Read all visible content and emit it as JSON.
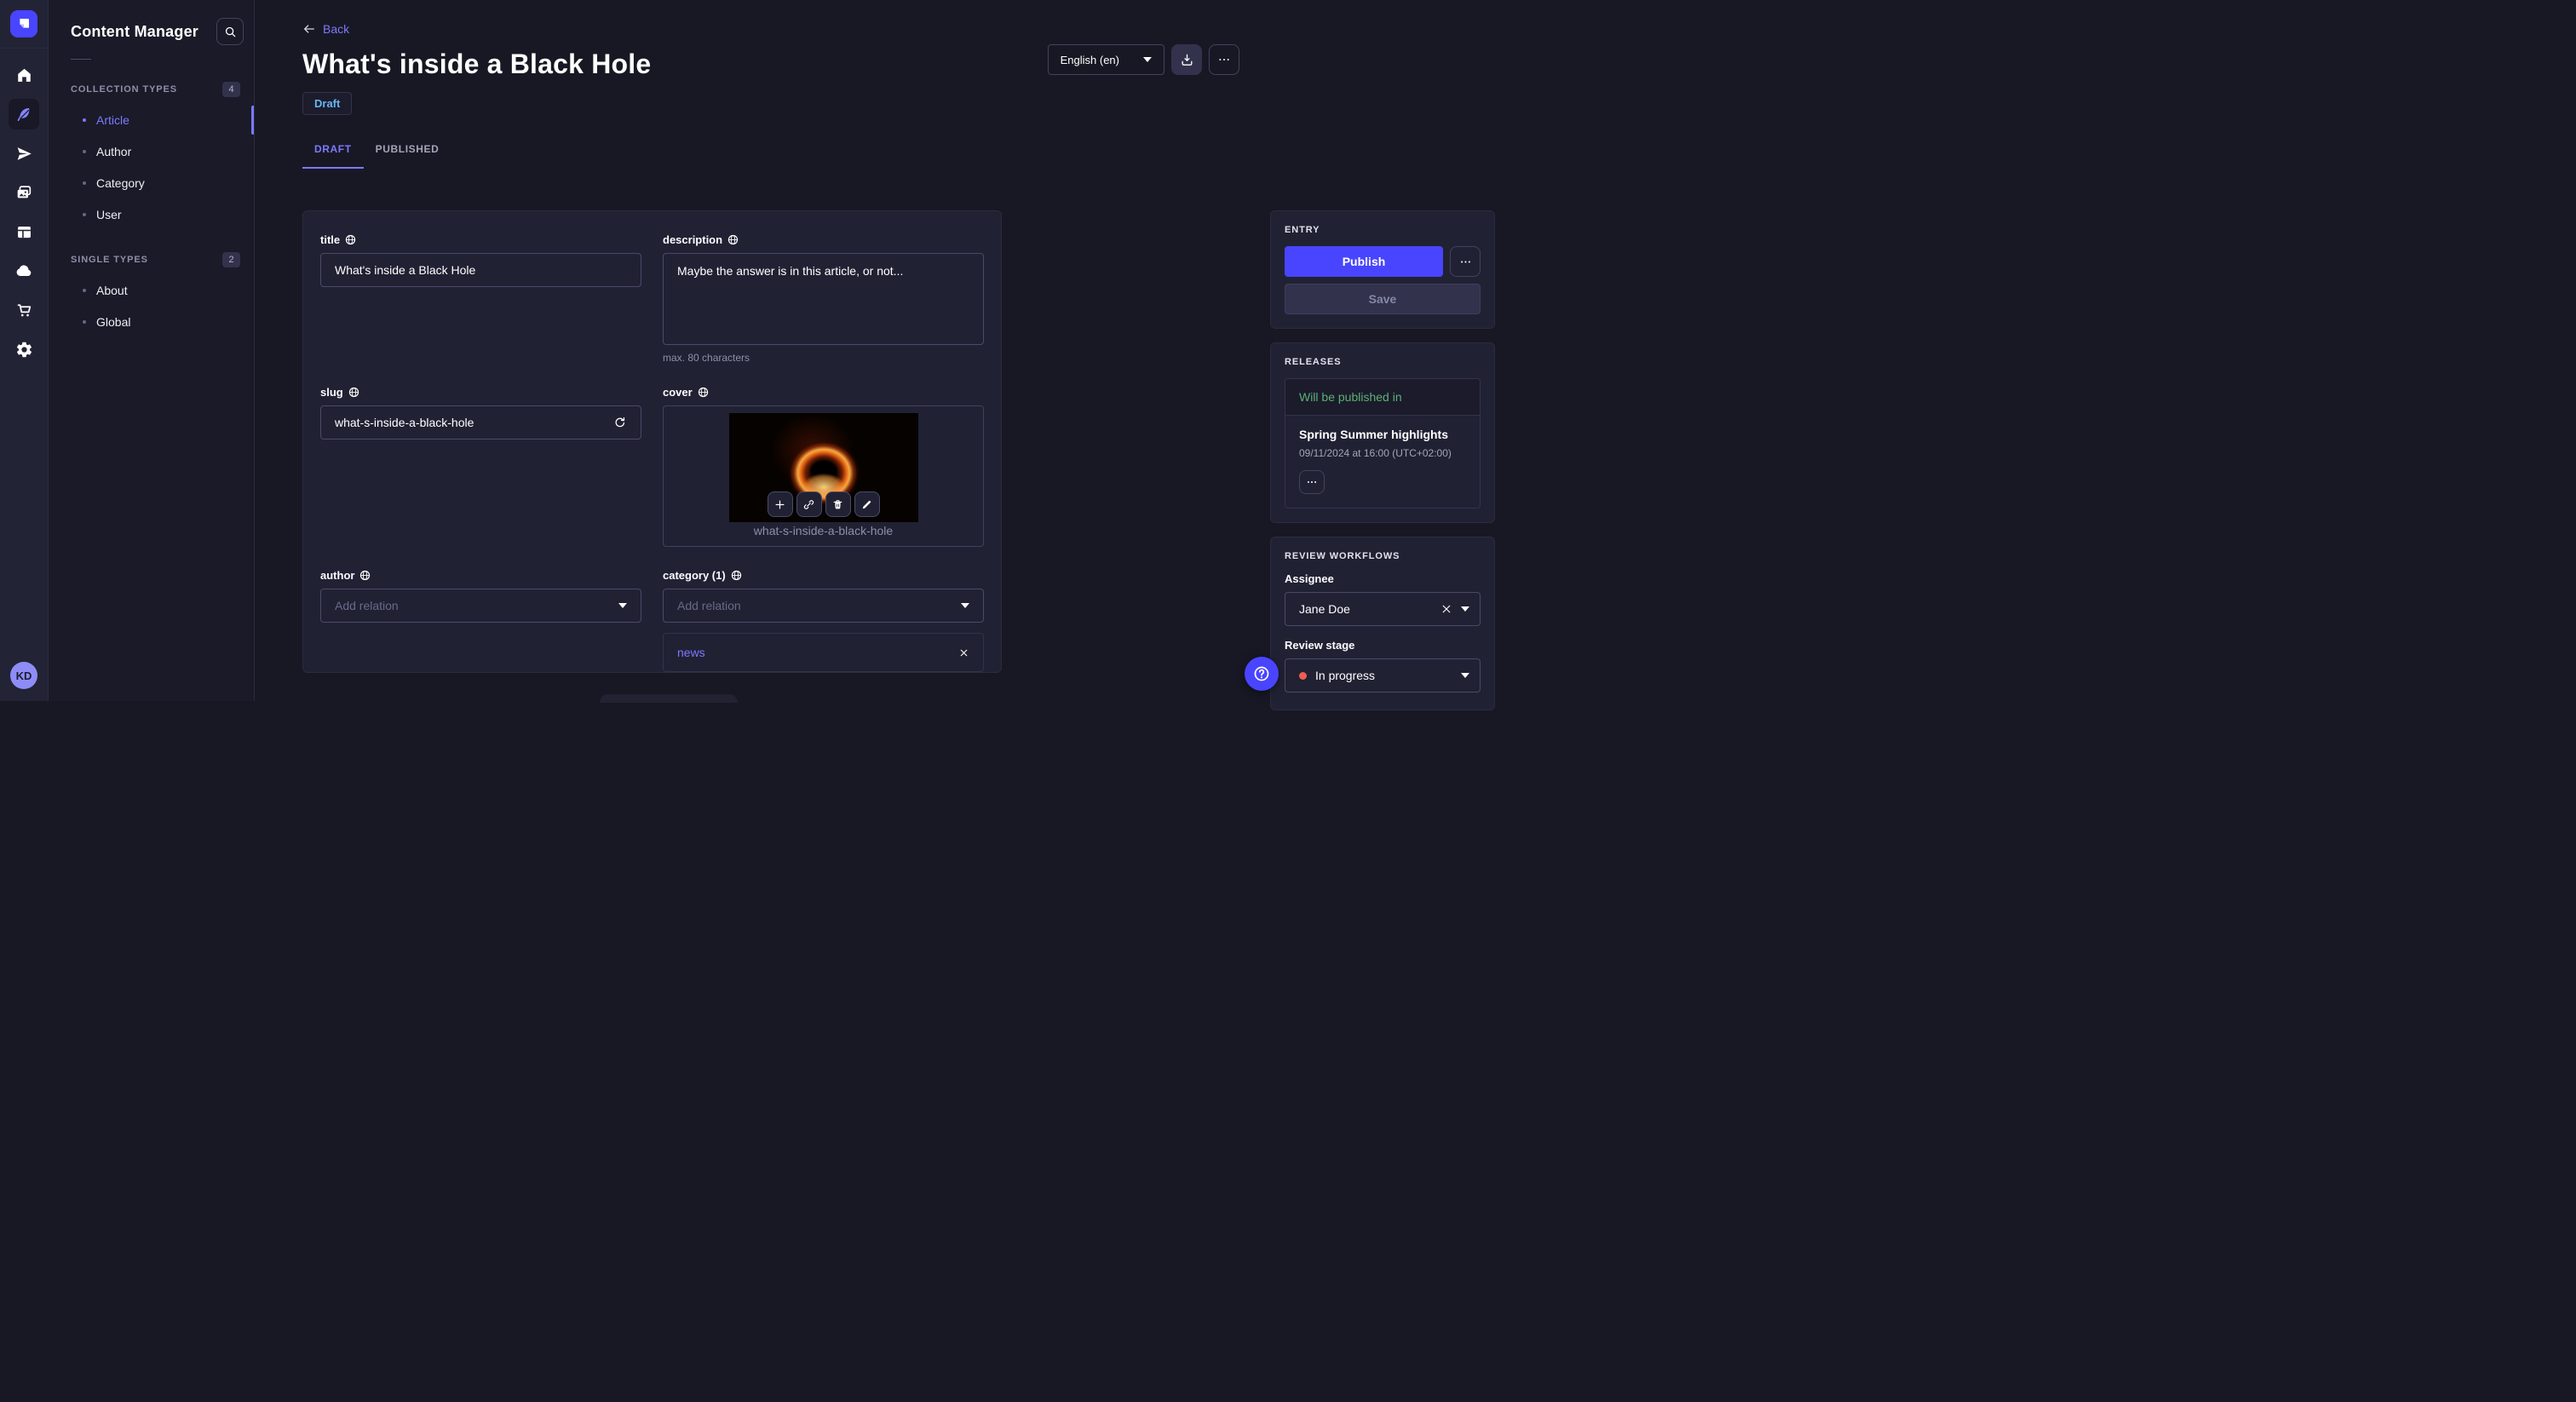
{
  "nav_rail": {
    "icons": [
      "home",
      "feather",
      "paper-plane",
      "media-library",
      "layout",
      "cloud",
      "cart",
      "settings"
    ],
    "avatar": "KD"
  },
  "subnav": {
    "title": "Content Manager",
    "collection_types": {
      "label": "COLLECTION TYPES",
      "count": "4",
      "items": [
        {
          "label": "Article",
          "active": true
        },
        {
          "label": "Author"
        },
        {
          "label": "Category"
        },
        {
          "label": "User"
        }
      ]
    },
    "single_types": {
      "label": "SINGLE TYPES",
      "count": "2",
      "items": [
        {
          "label": "About"
        },
        {
          "label": "Global"
        }
      ]
    }
  },
  "header": {
    "back": "Back",
    "title": "What's inside a Black Hole",
    "status": "Draft",
    "locale": "English (en)"
  },
  "tabs": [
    {
      "label": "DRAFT",
      "active": true
    },
    {
      "label": "PUBLISHED",
      "active": false
    }
  ],
  "form": {
    "title": {
      "label": "title",
      "value": "What's inside a Black Hole"
    },
    "description": {
      "label": "description",
      "value": "Maybe the answer is in this article, or not...",
      "hint": "max. 80 characters"
    },
    "slug": {
      "label": "slug",
      "value": "what-s-inside-a-black-hole"
    },
    "cover": {
      "label": "cover",
      "caption": "what-s-inside-a-black-hole"
    },
    "author": {
      "label": "author",
      "placeholder": "Add relation"
    },
    "category": {
      "label": "category (1)",
      "placeholder": "Add relation",
      "relation": "news"
    }
  },
  "entry": {
    "heading": "ENTRY",
    "publish": "Publish",
    "save": "Save"
  },
  "releases": {
    "heading": "RELEASES",
    "status": "Will be published in",
    "name": "Spring Summer highlights",
    "date": "09/11/2024 at 16:00 (UTC+02:00)"
  },
  "review": {
    "heading": "REVIEW WORKFLOWS",
    "assignee_label": "Assignee",
    "assignee": "Jane Doe",
    "stage_label": "Review stage",
    "stage": "In progress"
  },
  "colors": {
    "accent": "#4945ff",
    "link": "#7b79ff",
    "draft": "#66b7f1",
    "success": "#5cb176",
    "stage_dot": "#ee5e52"
  }
}
